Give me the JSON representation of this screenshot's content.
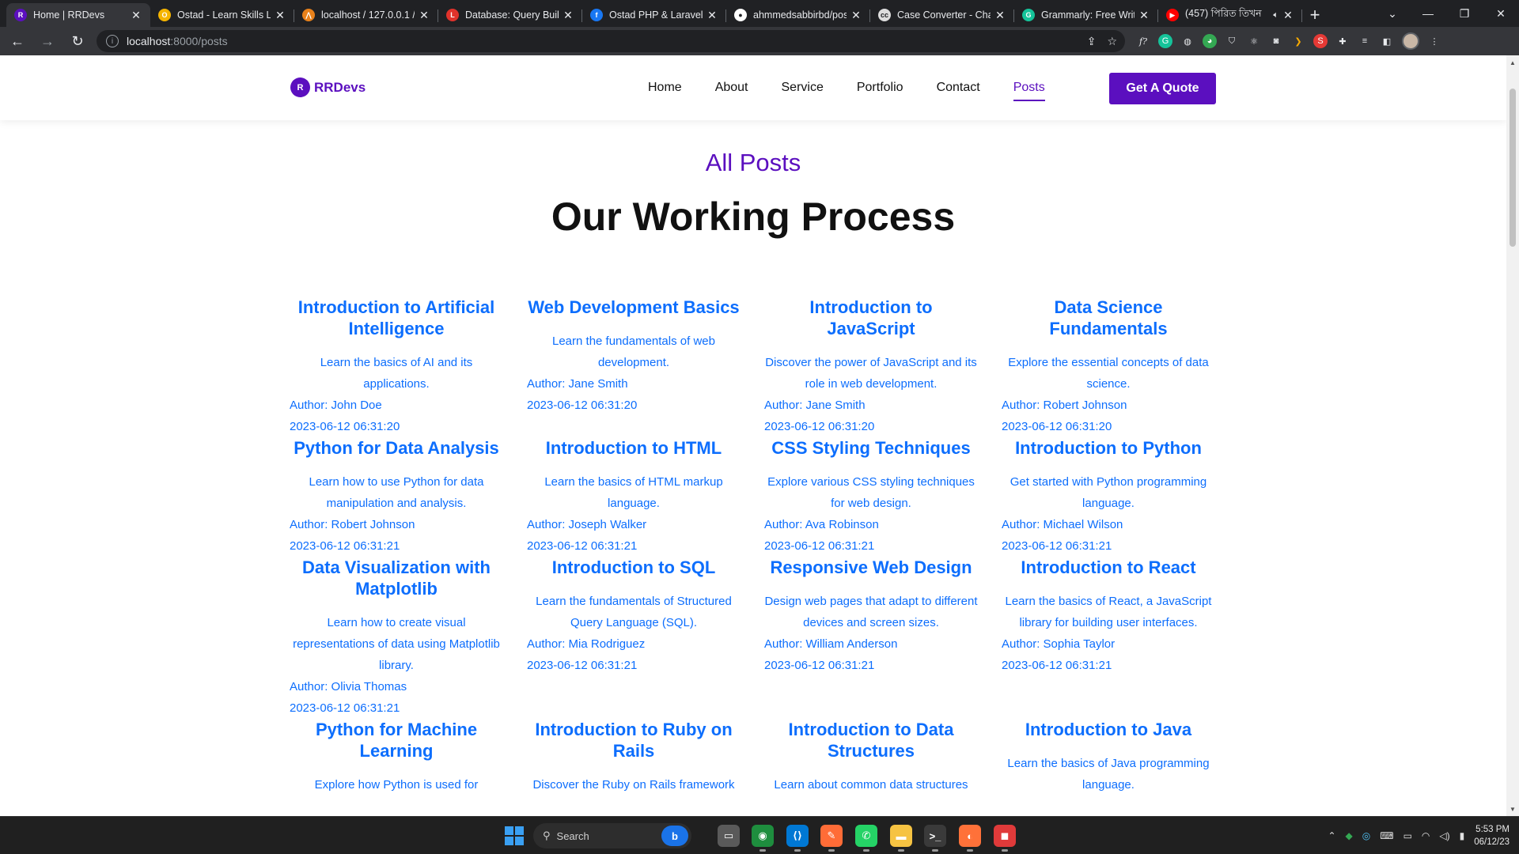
{
  "browser": {
    "tabs": [
      {
        "title": "Home | RRDevs",
        "favicon": "rrdevs-icon",
        "color": "#5b0fbf",
        "glyph": "R",
        "active": true
      },
      {
        "title": "Ostad - Learn Skills Li",
        "favicon": "ostad-icon",
        "color": "#f5b400",
        "glyph": "O",
        "active": false
      },
      {
        "title": "localhost / 127.0.0.1 / ",
        "favicon": "phpmyadmin-icon",
        "color": "#e8811a",
        "glyph": "⋀",
        "active": false
      },
      {
        "title": "Database: Query Build",
        "favicon": "laravel-icon",
        "color": "#e0322b",
        "glyph": "L",
        "active": false
      },
      {
        "title": "Ostad PHP & Laravel",
        "favicon": "facebook-icon",
        "color": "#1877f2",
        "glyph": "f",
        "active": false
      },
      {
        "title": "ahmmedsabbirbd/pos",
        "favicon": "github-icon",
        "color": "#ffffff",
        "glyph": "●",
        "active": false
      },
      {
        "title": "Case Converter - Char",
        "favicon": "case-converter-icon",
        "color": "#dddddd",
        "glyph": "cc",
        "active": false
      },
      {
        "title": "Grammarly: Free Writi",
        "favicon": "grammarly-icon",
        "color": "#15c39a",
        "glyph": "G",
        "active": false
      },
      {
        "title": "(457) পিরিত তিখন",
        "favicon": "youtube-icon",
        "color": "#ff0000",
        "glyph": "▶",
        "active": false,
        "audio": true
      }
    ],
    "close_glyph": "✕",
    "new_tab_glyph": "+",
    "url_host": "localhost",
    "url_path": ":8000/posts"
  },
  "site": {
    "logo_text": "RRDevs",
    "logo_mark": "R",
    "nav": [
      {
        "label": "Home",
        "active": false
      },
      {
        "label": "About",
        "active": false
      },
      {
        "label": "Service",
        "active": false
      },
      {
        "label": "Portfolio",
        "active": false
      },
      {
        "label": "Contact",
        "active": false
      },
      {
        "label": "Posts",
        "active": true
      }
    ],
    "cta_label": "Get A Quote",
    "section_sub": "All Posts",
    "section_title": "Our Working Process",
    "colors": {
      "brand": "#5b0fbf",
      "link": "#0d6efd"
    }
  },
  "posts": [
    {
      "title": "Introduction to Artificial Intelligence",
      "desc": "Learn the basics of AI and its applications.",
      "author": "Author: John Doe",
      "date": "2023-06-12 06:31:20"
    },
    {
      "title": "Web Development Basics",
      "desc": "Learn the fundamentals of web development.",
      "author": "Author: Jane Smith",
      "date": "2023-06-12 06:31:20"
    },
    {
      "title": "Introduction to JavaScript",
      "desc": "Discover the power of JavaScript and its role in web development.",
      "author": "Author: Jane Smith",
      "date": "2023-06-12 06:31:20"
    },
    {
      "title": "Data Science Fundamentals",
      "desc": "Explore the essential concepts of data science.",
      "author": "Author: Robert Johnson",
      "date": "2023-06-12 06:31:20"
    },
    {
      "title": "Python for Data Analysis",
      "desc": "Learn how to use Python for data manipulation and analysis.",
      "author": "Author: Robert Johnson",
      "date": "2023-06-12 06:31:21"
    },
    {
      "title": "Introduction to HTML",
      "desc": "Learn the basics of HTML markup language.",
      "author": "Author: Joseph Walker",
      "date": "2023-06-12 06:31:21"
    },
    {
      "title": "CSS Styling Techniques",
      "desc": "Explore various CSS styling techniques for web design.",
      "author": "Author: Ava Robinson",
      "date": "2023-06-12 06:31:21"
    },
    {
      "title": "Introduction to Python",
      "desc": "Get started with Python programming language.",
      "author": "Author: Michael Wilson",
      "date": "2023-06-12 06:31:21"
    },
    {
      "title": "Data Visualization with Matplotlib",
      "desc": "Learn how to create visual representations of data using Matplotlib library.",
      "author": "Author: Olivia Thomas",
      "date": "2023-06-12 06:31:21"
    },
    {
      "title": "Introduction to SQL",
      "desc": "Learn the fundamentals of Structured Query Language (SQL).",
      "author": "Author: Mia Rodriguez",
      "date": "2023-06-12 06:31:21"
    },
    {
      "title": "Responsive Web Design",
      "desc": "Design web pages that adapt to different devices and screen sizes.",
      "author": "Author: William Anderson",
      "date": "2023-06-12 06:31:21"
    },
    {
      "title": "Introduction to React",
      "desc": "Learn the basics of React, a JavaScript library for building user interfaces.",
      "author": "Author: Sophia Taylor",
      "date": "2023-06-12 06:31:21"
    },
    {
      "title": "Python for Machine Learning",
      "desc": "Explore how Python is used for",
      "author": "",
      "date": ""
    },
    {
      "title": "Introduction to Ruby on Rails",
      "desc": "Discover the Ruby on Rails framework",
      "author": "",
      "date": ""
    },
    {
      "title": "Introduction to Data Structures",
      "desc": "Learn about common data structures",
      "author": "",
      "date": ""
    },
    {
      "title": "Introduction to Java",
      "desc": "Learn the basics of Java programming language.",
      "author": "",
      "date": ""
    }
  ],
  "taskbar": {
    "search_placeholder": "Search",
    "bing_label": "b",
    "apps": [
      {
        "name": "task-view-icon",
        "color": "#5a5a5a",
        "glyph": "▭"
      },
      {
        "name": "chrome-icon",
        "color": "#1e8e3e",
        "glyph": "◉"
      },
      {
        "name": "vscode-icon",
        "color": "#0078d4",
        "glyph": "⟨⟩"
      },
      {
        "name": "postman-icon",
        "color": "#ff6c37",
        "glyph": "✎"
      },
      {
        "name": "whatsapp-icon",
        "color": "#25d366",
        "glyph": "✆"
      },
      {
        "name": "file-explorer-icon",
        "color": "#f6c342",
        "glyph": "▬"
      },
      {
        "name": "terminal-icon",
        "color": "#3a3a3a",
        "glyph": ">_"
      },
      {
        "name": "firefox-icon",
        "color": "#ff7139",
        "glyph": "◐"
      },
      {
        "name": "screen-recorder-icon",
        "color": "#e03a3a",
        "glyph": "◼"
      }
    ],
    "time": "5:53 PM",
    "date": "06/12/23"
  }
}
